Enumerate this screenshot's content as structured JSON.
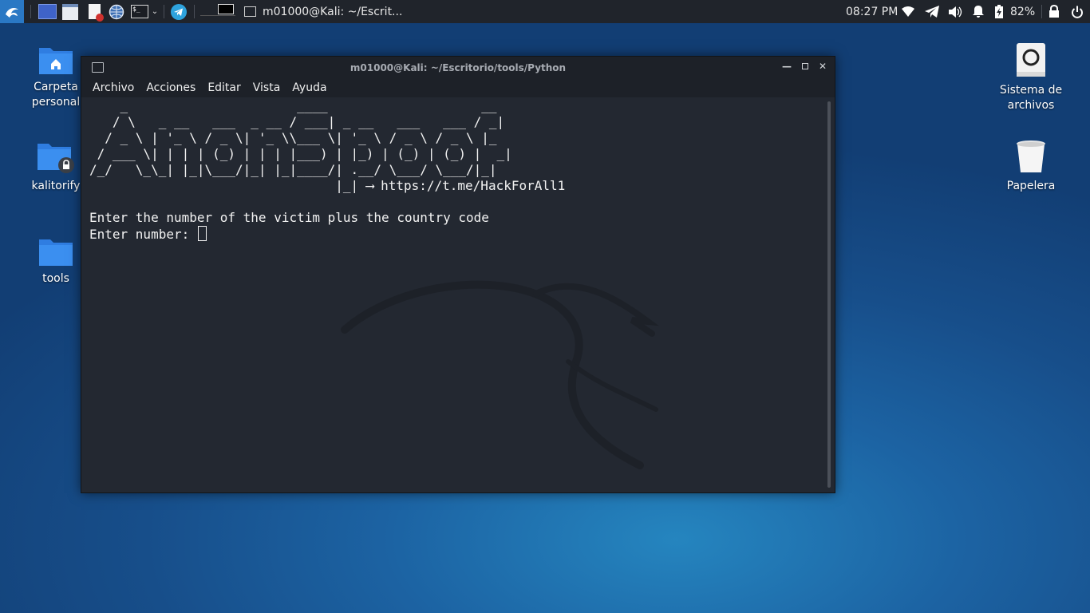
{
  "panel": {
    "task_title": "m01000@Kali: ~/Escrit...",
    "clock": "08:27 PM",
    "battery": "82%",
    "icons": [
      "kali-menu-icon",
      "workspace-icon",
      "file-manager-icon",
      "text-editor-icon",
      "web-browser-icon",
      "terminal-icon",
      "chevron-down-icon",
      "telegram-icon",
      "workspace-preview-icon",
      "terminal-task-icon",
      "wifi-icon",
      "telegram-tray-icon",
      "volume-icon",
      "notification-bell-icon",
      "battery-icon",
      "lock-icon",
      "power-icon"
    ]
  },
  "desktop": {
    "icons": [
      {
        "label": "Carpeta personal",
        "icon": "home-folder-icon"
      },
      {
        "label": "kalitorify",
        "icon": "locked-folder-icon"
      },
      {
        "label": "tools",
        "icon": "folder-icon"
      },
      {
        "label": "Sistema de archivos",
        "icon": "drive-icon"
      },
      {
        "label": "Papelera",
        "icon": "trash-icon"
      }
    ]
  },
  "terminal": {
    "title": "m01000@Kali: ~/Escritorio/tools/Python",
    "menu": [
      "Archivo",
      "Acciones",
      "Editar",
      "Vista",
      "Ayuda"
    ],
    "banner": "    _                      ____                    __\n   / \\   _ __   ___  _ __ / ___| _ __   ___   ___ / _|\n  / _ \\ | '_ \\ / _ \\| '_ \\\\___ \\| '_ \\ / _ \\ / _ \\ |_\n / ___ \\| | | | (_) | | | |___) | |_) | (_) | (_) |  _|\n/_/   \\_\\_| |_|\\___/|_| |_|____/| .__/ \\___/ \\___/|_|\n                                |_|",
    "link": "https://t.me/HackForAll1",
    "arrow": "⟶",
    "prompt_line": "Enter the number of the victim plus the country code",
    "input_label": "Enter number: "
  }
}
